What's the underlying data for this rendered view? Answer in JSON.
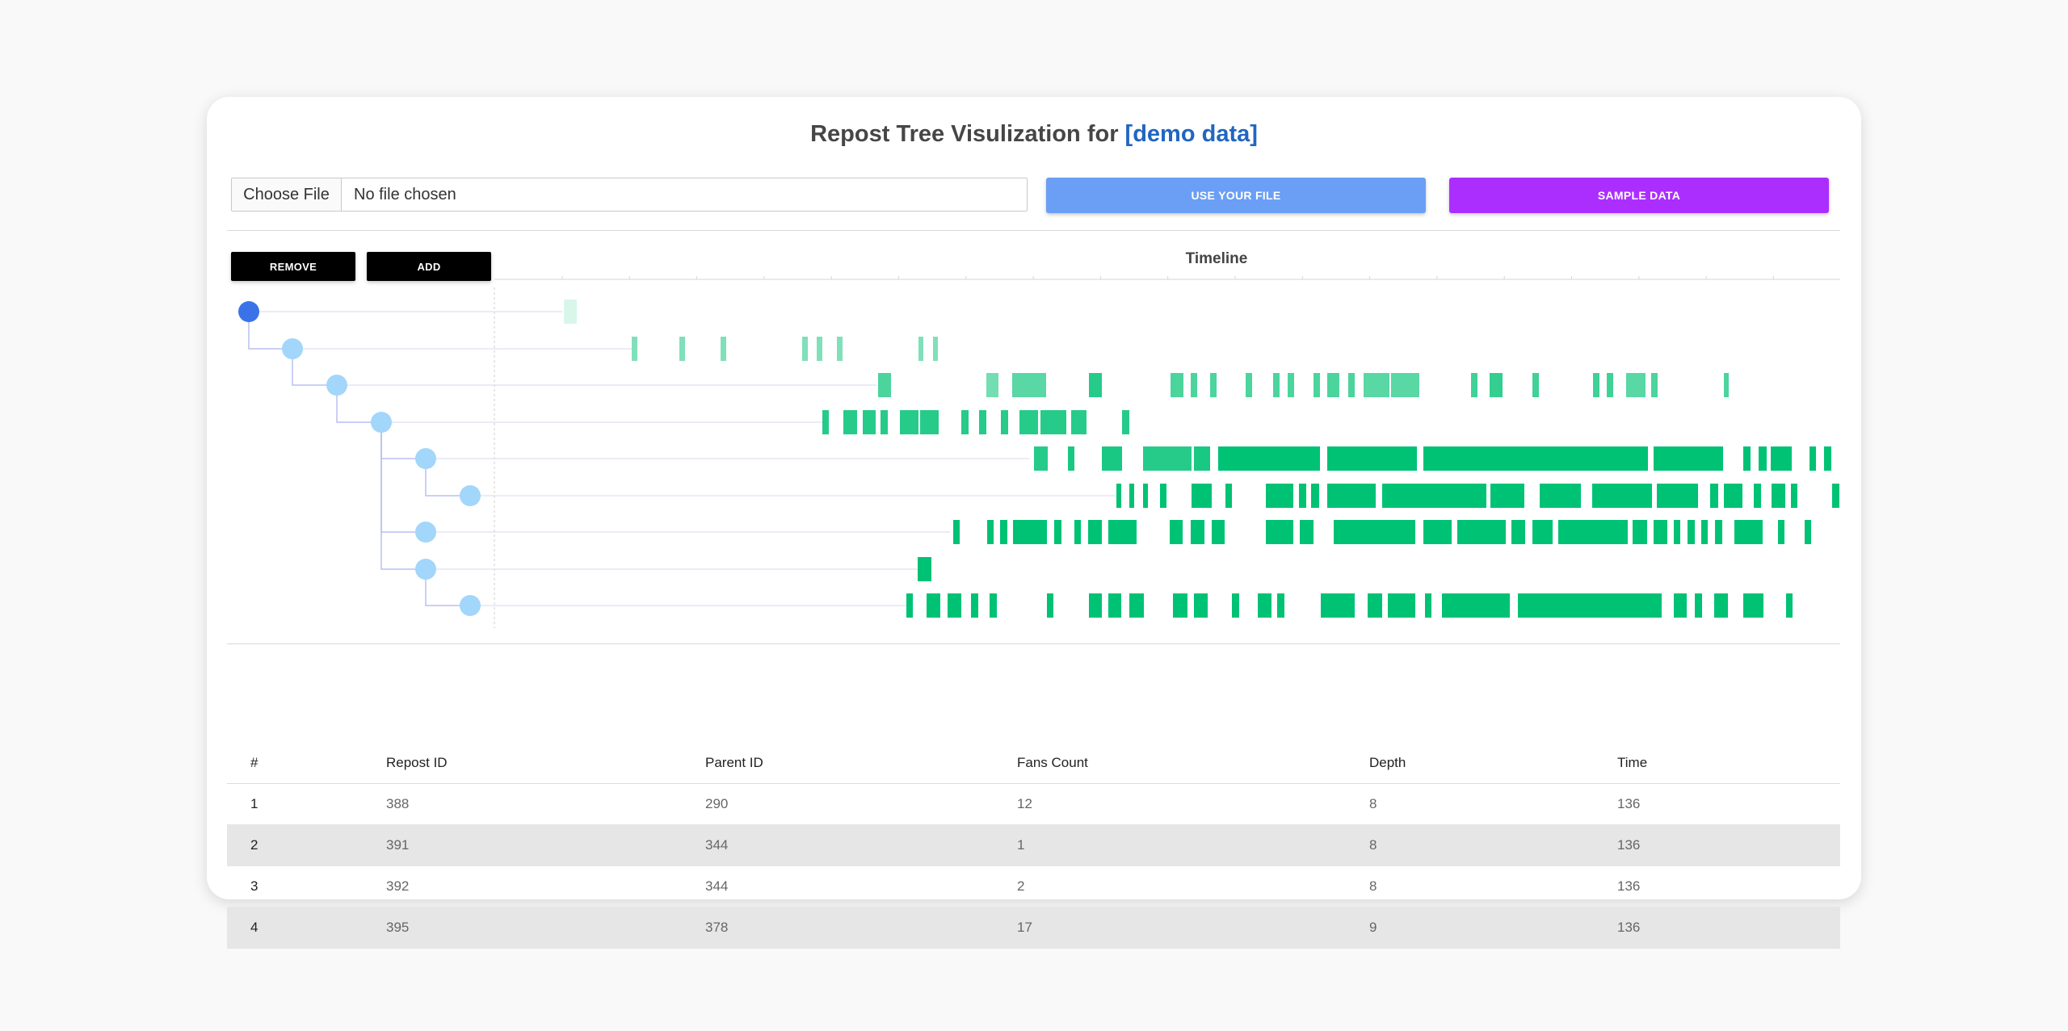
{
  "header": {
    "title_prefix": "Repost Tree Visulization for ",
    "title_highlight": "[demo data]"
  },
  "file_input": {
    "button_label": "Choose File",
    "status": "No file chosen"
  },
  "buttons": {
    "use_your_file": "USE YOUR FILE",
    "sample_data": "SAMPLE DATA",
    "remove": "REMOVE",
    "add": "ADD"
  },
  "timeline": {
    "label": "Timeline"
  },
  "colors": {
    "root_node": "#3a73e8",
    "node": "#a2d6fa",
    "tree_line": "#b8bff2",
    "bar": "#00c274",
    "bar_faint": "#dafbe9",
    "use_button": "#6a9ff5",
    "sample_button": "#ac2eff"
  },
  "table": {
    "headers": [
      "#",
      "Repost ID",
      "Parent ID",
      "Fans Count",
      "Depth",
      "Time"
    ],
    "rows": [
      [
        "1",
        "388",
        "290",
        "12",
        "8",
        "136"
      ],
      [
        "2",
        "391",
        "344",
        "1",
        "8",
        "136"
      ],
      [
        "3",
        "392",
        "344",
        "2",
        "8",
        "136"
      ],
      [
        "4",
        "395",
        "378",
        "17",
        "9",
        "136"
      ]
    ]
  }
}
